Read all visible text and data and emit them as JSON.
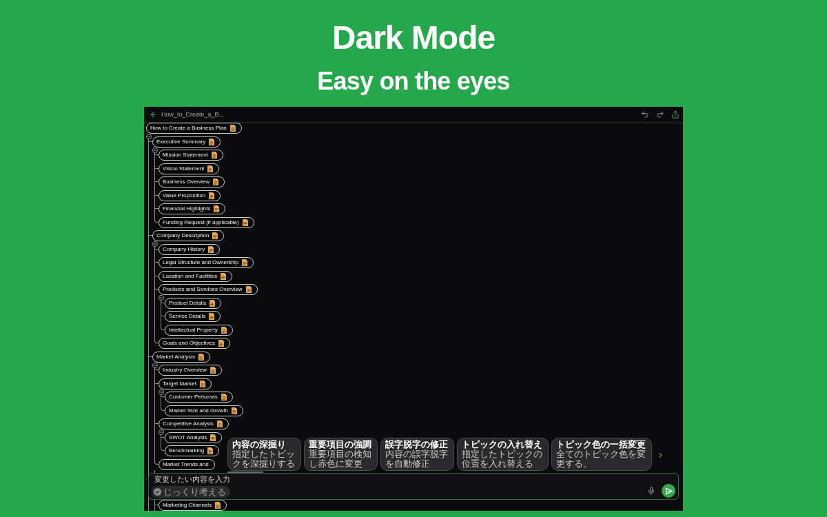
{
  "headline": {
    "title": "Dark Mode",
    "subtitle": "Easy on the eyes"
  },
  "app": {
    "top_bar": {
      "title": "How_to_Create_a_B..."
    },
    "mind_map": {
      "root": {
        "label": "How to Create a Business Plan",
        "note": true,
        "expanded": true,
        "children": [
          {
            "label": "Executive Summary",
            "note": true,
            "expanded": true,
            "children": [
              {
                "label": "Mission Statement",
                "note": true
              },
              {
                "label": "Vision Statement",
                "note": true
              },
              {
                "label": "Business Overview",
                "note": true
              },
              {
                "label": "Value Proposition",
                "note": true
              },
              {
                "label": "Financial Highlights",
                "note": true
              },
              {
                "label": "Funding Request (if applicable)",
                "note": true
              }
            ]
          },
          {
            "label": "Company Description",
            "note": true,
            "expanded": true,
            "children": [
              {
                "label": "Company History",
                "note": true
              },
              {
                "label": "Legal Structure and Ownership",
                "note": true
              },
              {
                "label": "Location and Facilities",
                "note": true
              },
              {
                "label": "Products and Services Overview",
                "note": true,
                "expanded": true,
                "children": [
                  {
                    "label": "Product Details",
                    "note": true
                  },
                  {
                    "label": "Service Details",
                    "note": true
                  },
                  {
                    "label": "Intellectual Property",
                    "note": true
                  }
                ]
              },
              {
                "label": "Goals and Objectives",
                "note": true
              }
            ]
          },
          {
            "label": "Market Analysis",
            "note": true,
            "expanded": true,
            "children": [
              {
                "label": "Industry Overview",
                "note": true
              },
              {
                "label": "Target Market",
                "note": true,
                "expanded": true,
                "children": [
                  {
                    "label": "Customer Personas",
                    "note": true
                  },
                  {
                    "label": "Market Size and Growth",
                    "note": true
                  }
                ]
              },
              {
                "label": "Competitive Analysis",
                "note": true,
                "expanded": true,
                "children": [
                  {
                    "label": "SWOT Analysis",
                    "note": true
                  },
                  {
                    "label": "Benchmarking",
                    "note": true
                  }
                ]
              },
              {
                "label": "Market Trends and",
                "note": false
              }
            ]
          }
        ]
      },
      "rows_below_input": [
        {
          "label": "Marketing Channels",
          "note": true
        }
      ]
    },
    "suggestions": [
      {
        "title": "内容の深掘り",
        "description": "指定したトピックを深掘りする"
      },
      {
        "title": "重要項目の強調",
        "description": "重要項目の検知し赤色に変更"
      },
      {
        "title": "誤字脱字の修正",
        "description": "内容の誤字脱字を自動修正"
      },
      {
        "title": "トピックの入れ替え",
        "description": "指定したトピックの位置を入れ替える"
      },
      {
        "title": "トピック色の一括変更",
        "description": "全てのトピック色を変更する。"
      }
    ],
    "composer": {
      "placeholder": "変更したい内容を入力",
      "think_toggle": {
        "label": "じっくり考える",
        "selected": false
      }
    }
  }
}
